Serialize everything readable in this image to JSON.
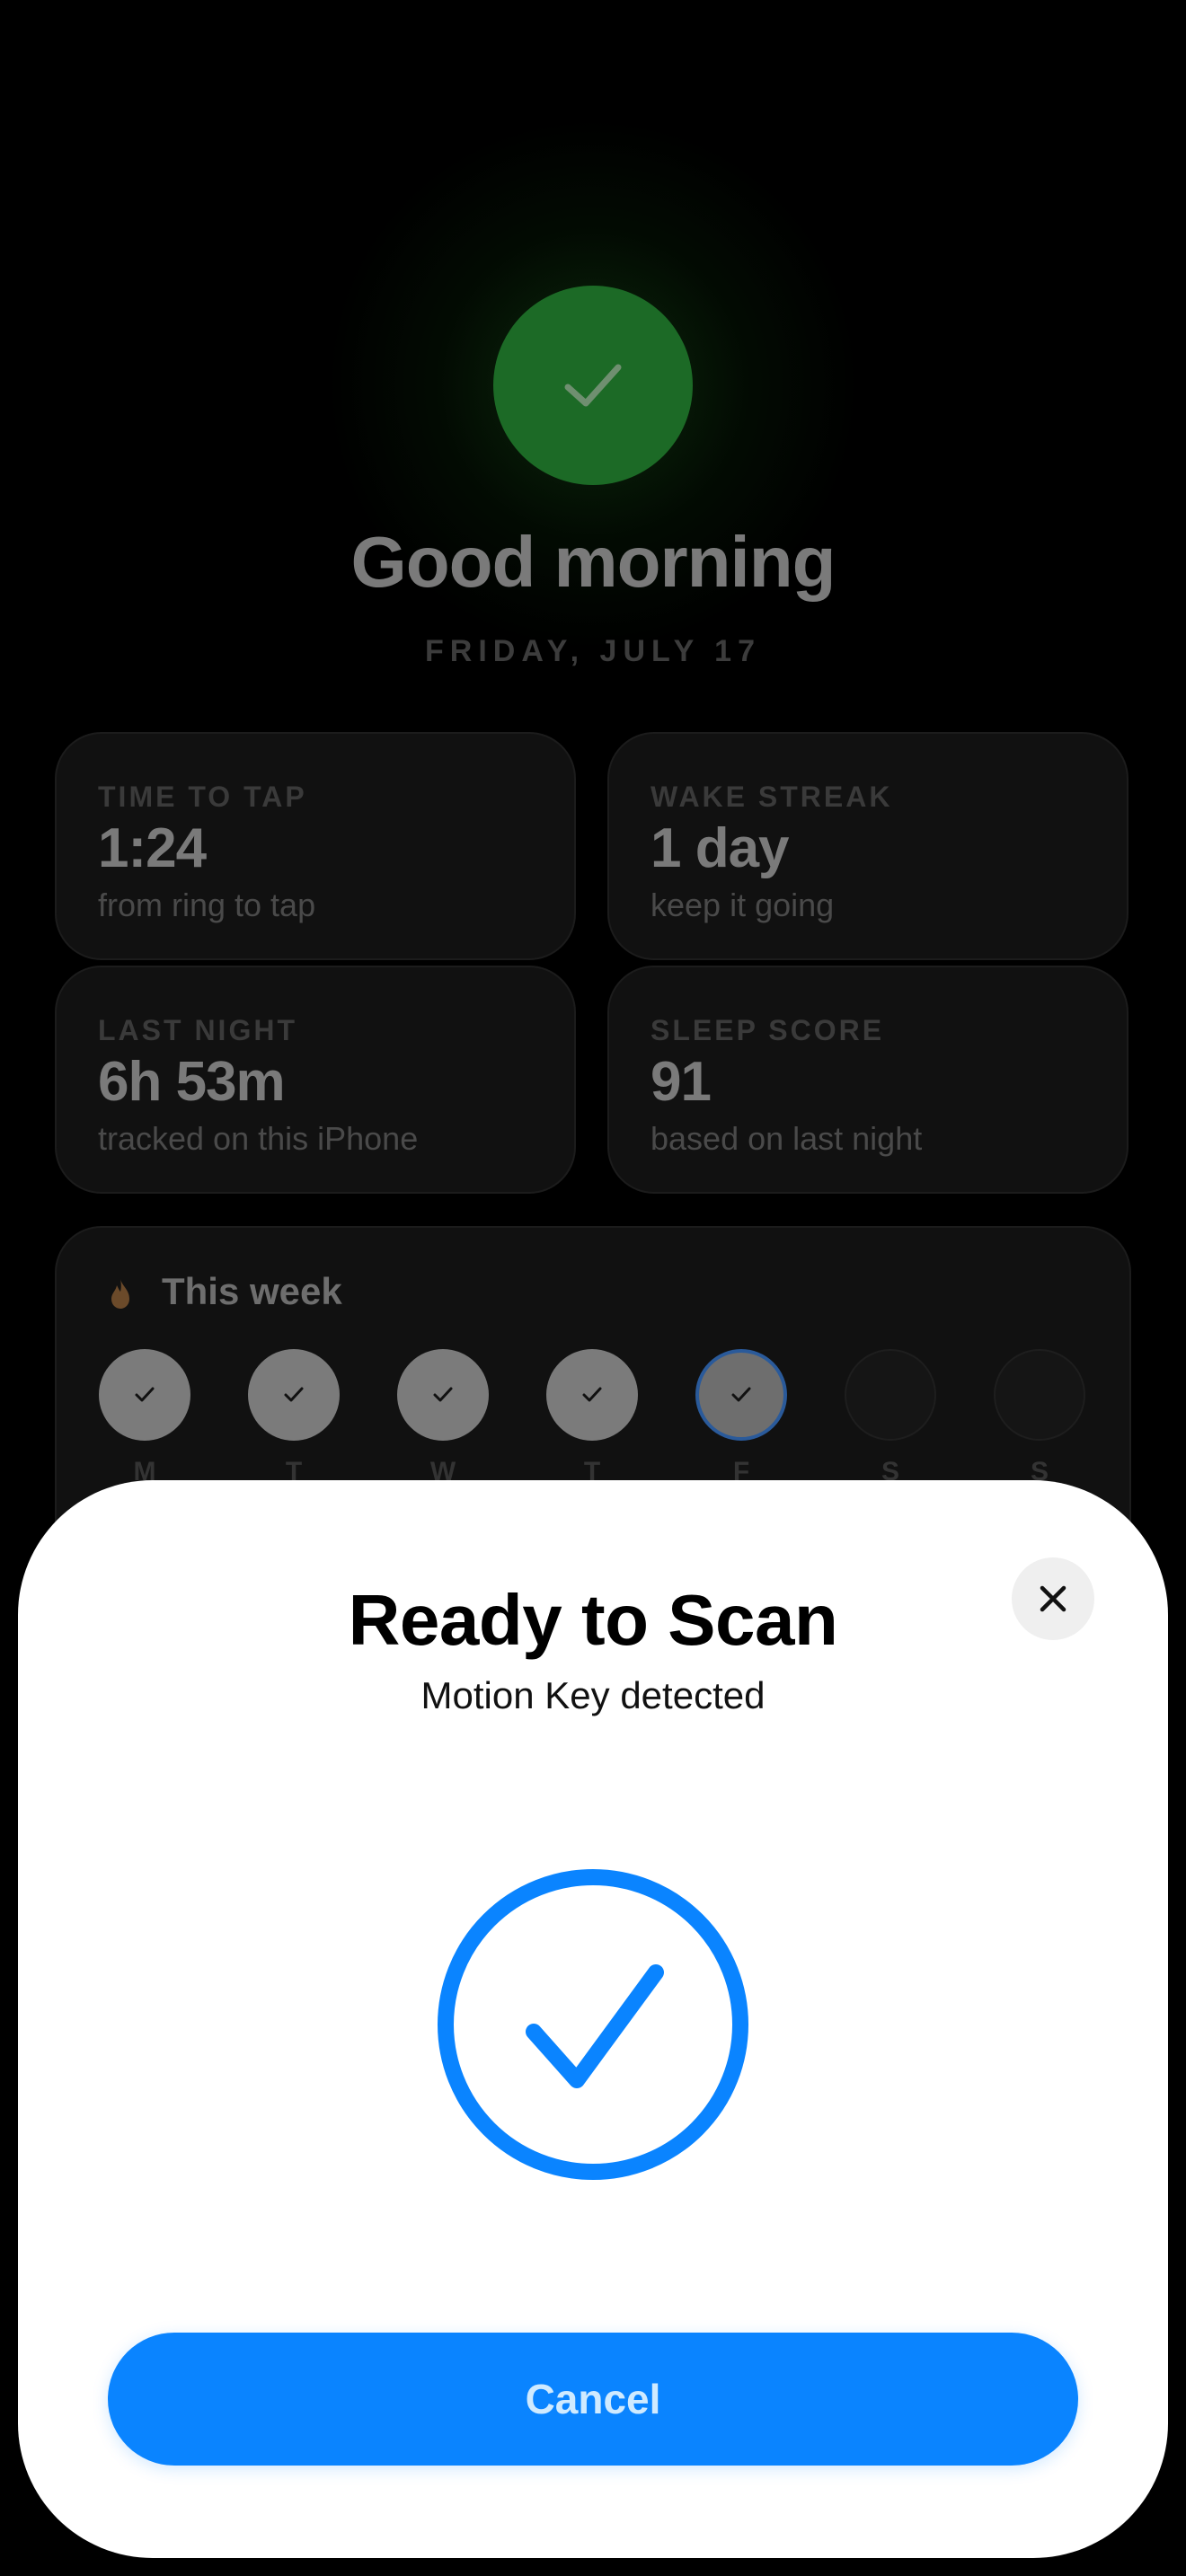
{
  "home": {
    "greeting": "Good morning",
    "date": "FRIDAY, JULY 17",
    "stats": [
      {
        "label": "TIME TO TAP",
        "value": "1:24",
        "sub": "from ring to tap"
      },
      {
        "label": "WAKE STREAK",
        "value": "1 day",
        "sub": "keep it going"
      },
      {
        "label": "LAST NIGHT",
        "value": "6h 53m",
        "sub": "tracked on this iPhone"
      },
      {
        "label": "SLEEP SCORE",
        "value": "91",
        "sub": "based on last night"
      }
    ],
    "week": {
      "title": "This week",
      "icon": "flame-icon",
      "days": [
        {
          "letter": "M",
          "state": "done"
        },
        {
          "letter": "T",
          "state": "done"
        },
        {
          "letter": "W",
          "state": "done"
        },
        {
          "letter": "T",
          "state": "done"
        },
        {
          "letter": "F",
          "state": "today"
        },
        {
          "letter": "S",
          "state": "empty"
        },
        {
          "letter": "S",
          "state": "empty"
        }
      ]
    }
  },
  "sheet": {
    "title": "Ready to Scan",
    "subtitle": "Motion Key detected",
    "status_icon": "checkmark-circle-icon",
    "cancel_label": "Cancel",
    "close_icon": "close-icon"
  },
  "colors": {
    "accent": "#0a84ff",
    "success": "#1c6a26",
    "sheet_background": "#ffffff",
    "app_background": "#000000"
  }
}
